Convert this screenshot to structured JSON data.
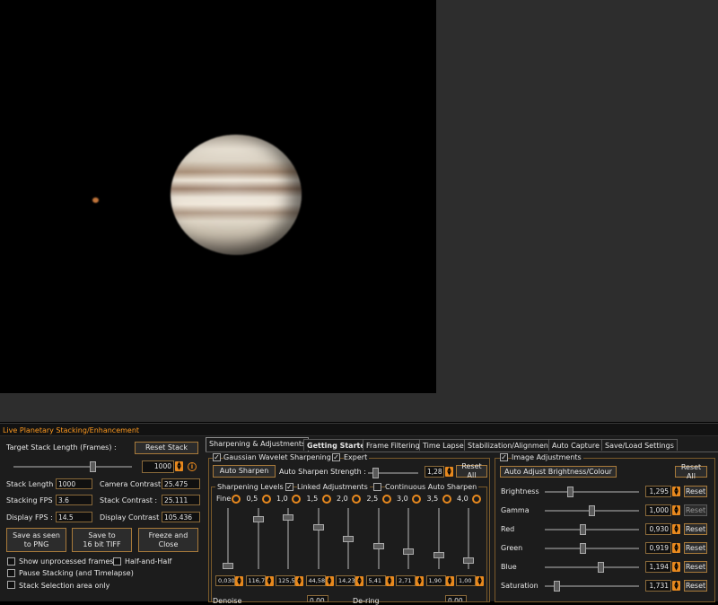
{
  "panel_title": "Live Planetary Stacking/Enhancement",
  "left": {
    "target_label": "Target Stack Length (Frames) :",
    "reset_stack": "Reset Stack",
    "target_value": "1000",
    "target_slider_level": 0.68,
    "stack_length_label": "Stack Length :",
    "stack_length": "1000",
    "stacking_fps_label": "Stacking FPS :",
    "stacking_fps": "3.6",
    "display_fps_label": "Display FPS :",
    "display_fps": "14.5",
    "camera_contrast_label": "Camera Contrast :",
    "camera_contrast": "25.475",
    "stack_contrast_label": "Stack Contrast :",
    "stack_contrast": "25.111",
    "display_contrast_label": "Display Contrast :",
    "display_contrast": "105.436",
    "save_png_1": "Save as seen",
    "save_png_2": "to PNG",
    "save_tiff_1": "Save to",
    "save_tiff_2": "16 bit TIFF",
    "freeze_1": "Freeze and",
    "freeze_2": "Close",
    "show_unprocessed": "Show unprocessed frames",
    "half_and_half": "Half-and-Half",
    "pause_stacking": "Pause Stacking (and Timelapse)",
    "stack_selection": "Stack Selection area only"
  },
  "tabs": [
    "Sharpening & Adjustments",
    "Getting Started",
    "Frame Filtering",
    "Time Lapse",
    "Stabilization/Alignment",
    "Auto Capture",
    "Save/Load Settings"
  ],
  "sharpen": {
    "gaussian_label": "Gaussian Wavelet Sharpening",
    "expert_label": "Expert",
    "auto_sharpen": "Auto Sharpen",
    "strength_label": "Auto Sharpen Strength :",
    "strength_value": "1,28",
    "strength_level": 0.1,
    "reset_all": "Reset All",
    "levels_label": "Sharpening Levels",
    "linked_label": "Linked Adjustments",
    "continuous_label": "Continuous Auto Sharpen",
    "levels": [
      {
        "name": "Fine",
        "value": "0,030",
        "level": 0.0
      },
      {
        "name": "0,5",
        "value": "116,7",
        "level": 0.85
      },
      {
        "name": "1,0",
        "value": "125,5",
        "level": 0.88
      },
      {
        "name": "1,5",
        "value": "44,58",
        "level": 0.7
      },
      {
        "name": "2,0",
        "value": "14,23",
        "level": 0.5
      },
      {
        "name": "2,5",
        "value": "5,41",
        "level": 0.36
      },
      {
        "name": "3,0",
        "value": "2,71",
        "level": 0.27
      },
      {
        "name": "3,5",
        "value": "1,90",
        "level": 0.19
      },
      {
        "name": "4,0",
        "value": "1,00",
        "level": 0.1
      }
    ],
    "denoise_label": "Denoise",
    "denoise_value": "0,00",
    "deringe_label": "De-ring",
    "deringe_value": "0,00"
  },
  "image_adj": {
    "label": "Image Adjustments",
    "auto_adjust": "Auto Adjust Brightness/Colour",
    "reset_all": "Reset All",
    "reset": "Reset",
    "rows": [
      {
        "name": "Brightness",
        "value": "1,295",
        "level": 0.25
      },
      {
        "name": "Gamma",
        "value": "1,000",
        "level": 0.5
      },
      {
        "name": "Red",
        "value": "0,930",
        "level": 0.4
      },
      {
        "name": "Green",
        "value": "0,919",
        "level": 0.4
      },
      {
        "name": "Blue",
        "value": "1,194",
        "level": 0.6
      },
      {
        "name": "Saturation",
        "value": "1,731",
        "level": 0.1
      }
    ]
  },
  "colors": {
    "accent": "#e8891e",
    "title": "#ff9a1f"
  }
}
